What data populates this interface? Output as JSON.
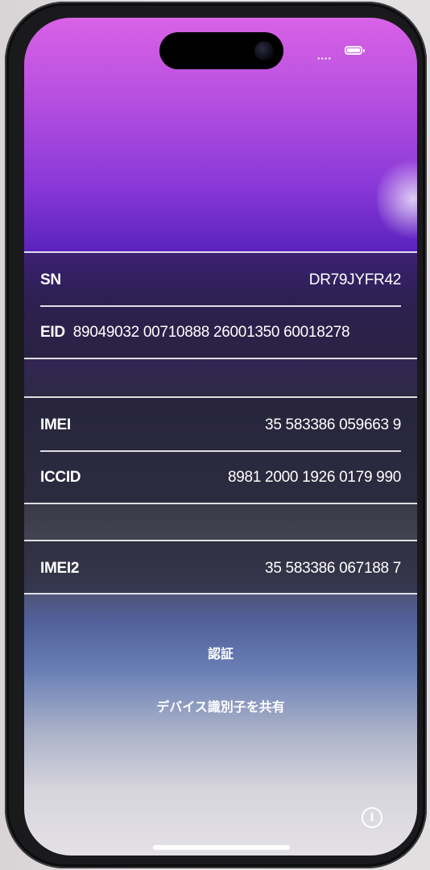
{
  "device_info": {
    "sn": {
      "label": "SN",
      "value": "DR79JYFR42"
    },
    "eid": {
      "label": "EID",
      "value": "89049032 00710888 26001350 60018278"
    },
    "imei": {
      "label": "IMEI",
      "value": "35 583386 059663 9"
    },
    "iccid": {
      "label": "ICCID",
      "value": "8981 2000 1926 0179 990"
    },
    "imei2": {
      "label": "IMEI2",
      "value": "35 583386 067188 7"
    }
  },
  "actions": {
    "certify": "認証",
    "share_identifiers": "デバイス識別子を共有"
  },
  "status_bar": {
    "signal_icon": "signal-dots-icon",
    "battery_icon": "battery-icon"
  },
  "colors": {
    "wallpaper_top": "#d962e6",
    "wallpaper_mid": "#5a22bd",
    "wallpaper_bottom": "#e4e1e6",
    "text": "#ffffff"
  }
}
